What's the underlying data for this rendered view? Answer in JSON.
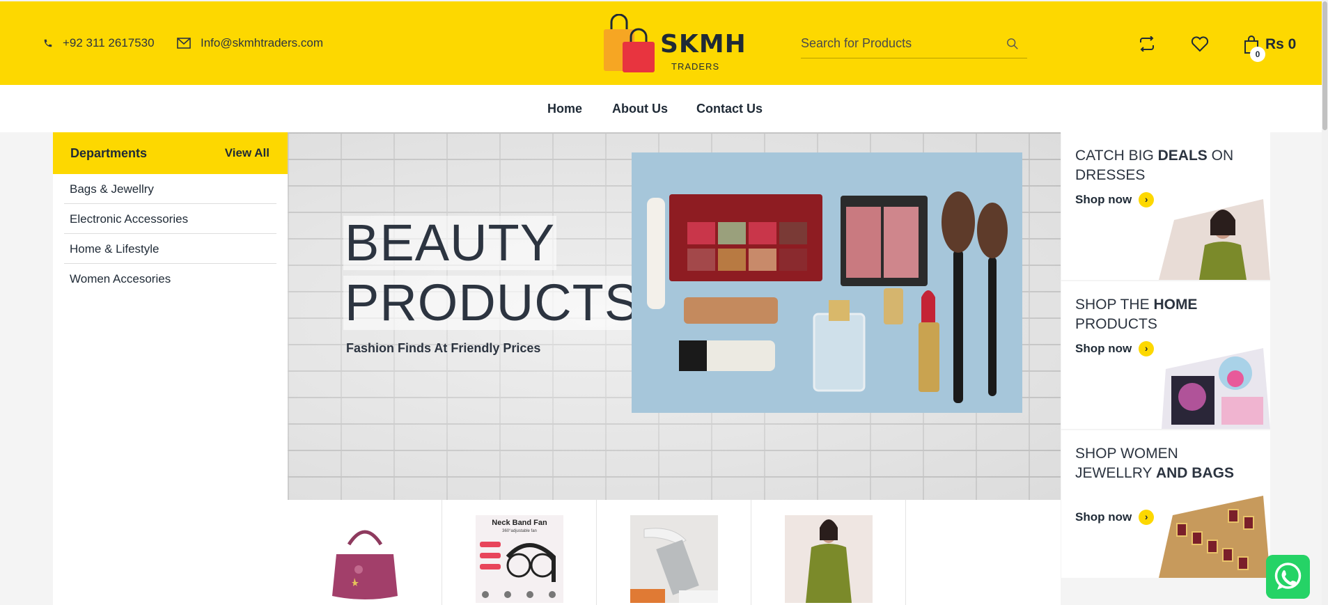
{
  "header": {
    "phone": "+92 311 2617530",
    "email": "Info@skmhtraders.com",
    "logo_name": "SKMH",
    "logo_sub": "TRADERS",
    "search_placeholder": "Search for Products",
    "cart_count": "0",
    "cart_total": "Rs 0"
  },
  "nav": {
    "items": [
      "Home",
      "About Us",
      "Contact Us"
    ]
  },
  "departments": {
    "title": "Departments",
    "view_all": "View All",
    "items": [
      "Bags & Jewellry",
      "Electronic Accessories",
      "Home & Lifestyle",
      "Women Accesories"
    ]
  },
  "hero": {
    "title_line1": "BEAUTY",
    "title_line2": "PRODUCTS",
    "subtitle": "Fashion Finds At Friendly Prices"
  },
  "promos": [
    {
      "pre": "CATCH BIG ",
      "bold": "DEALS",
      "post": " ON DRESSES",
      "link": "Shop now"
    },
    {
      "pre": "SHOP THE ",
      "bold": "HOME",
      "post": " PRODUCTS",
      "link": "Shop now"
    },
    {
      "pre": "SHOP WOMEN JEWELLRY ",
      "bold": "AND BAGS",
      "post": "",
      "link": "Shop now"
    }
  ],
  "products": {
    "fan_label": "Neck Band Fan",
    "fan_sub": "360°adjustable fan"
  },
  "colors": {
    "brand_yellow": "#fdd800",
    "text_dark": "#1f2a36",
    "whatsapp_green": "#25d366"
  }
}
